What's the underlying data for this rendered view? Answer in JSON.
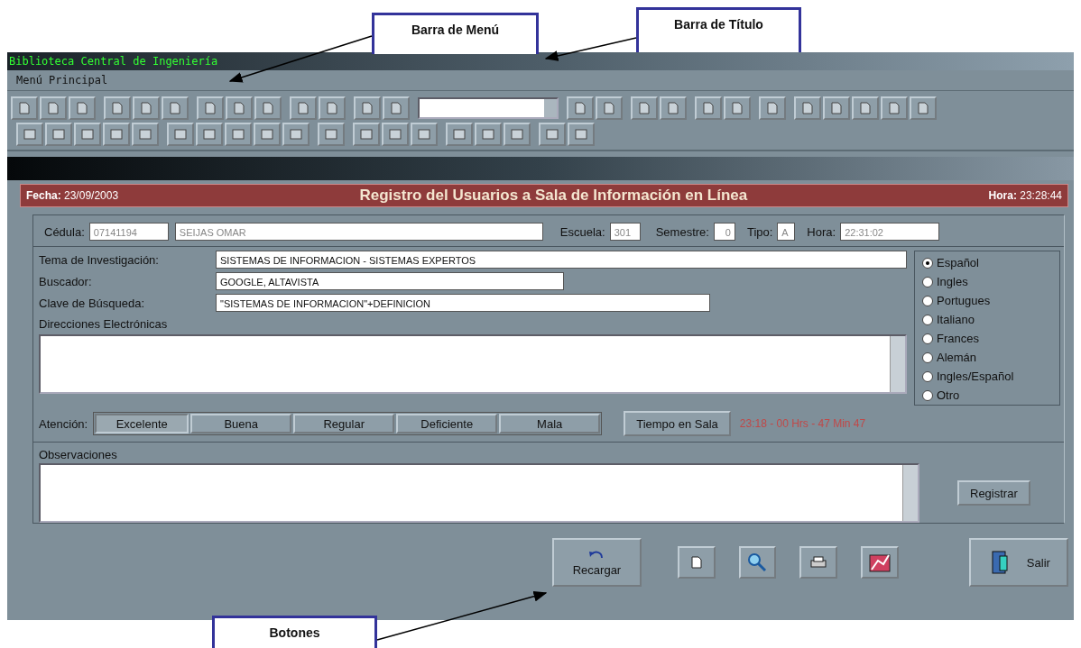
{
  "annotations": [
    {
      "label": "Barra de Menú"
    },
    {
      "label": "Barra de Título"
    },
    {
      "label": "Botones"
    }
  ],
  "window": {
    "title": "Biblioteca Central de Ingeniería"
  },
  "menu": [
    "Menú Principal"
  ],
  "header": {
    "date_label": "Fecha:",
    "date": "23/09/2003",
    "title": "Registro del Usuarios a Sala de Información en Línea",
    "time_label": "Hora:",
    "time": "23:28:44"
  },
  "identity": [
    {
      "label": "Cédula:",
      "value": "07141194"
    },
    {
      "value": "SEIJAS OMAR"
    },
    {
      "label": "Escuela:",
      "value": "301"
    },
    {
      "label": "Semestre:",
      "value": "0"
    },
    {
      "label": "Tipo:",
      "value": "A"
    },
    {
      "label": "Hora:",
      "value": "22:31:02"
    }
  ],
  "research": [
    {
      "label": "Tema de Investigación:",
      "value": "SISTEMAS DE INFORMACION - SISTEMAS EXPERTOS"
    },
    {
      "label": "Buscador:",
      "value": "GOOGLE, ALTAVISTA"
    },
    {
      "label": "Clave de Búsqueda:",
      "value": "\"SISTEMAS DE INFORMACION\"+DEFINICION"
    }
  ],
  "emails_label": "Direcciones Electrónicas",
  "languages": [
    {
      "label": "Español",
      "selected": true
    },
    {
      "label": "Ingles",
      "selected": false
    },
    {
      "label": "Portugues",
      "selected": false
    },
    {
      "label": "Italiano",
      "selected": false
    },
    {
      "label": "Frances",
      "selected": false
    },
    {
      "label": "Alemán",
      "selected": false
    },
    {
      "label": "Ingles/Español",
      "selected": false
    },
    {
      "label": "Otro",
      "selected": false
    }
  ],
  "attention": {
    "label": "Atención:",
    "options": [
      {
        "label": "Excelente",
        "selected": true
      },
      {
        "label": "Buena",
        "selected": false
      },
      {
        "label": "Regular",
        "selected": false
      },
      {
        "label": "Deficiente",
        "selected": false
      },
      {
        "label": "Mala",
        "selected": false
      }
    ]
  },
  "time_button": "Tiempo en Sala",
  "elapsed": "23:18 - 00 Hrs - 47 Min 47",
  "observations_label": "Observaciones",
  "register_button": "Registrar",
  "bottom_buttons": [
    {
      "kind": "reload",
      "label": "Recargar"
    },
    {
      "kind": "new"
    },
    {
      "kind": "search"
    },
    {
      "kind": "print"
    },
    {
      "kind": "chart"
    },
    {
      "kind": "exit",
      "label": "Salir"
    }
  ]
}
